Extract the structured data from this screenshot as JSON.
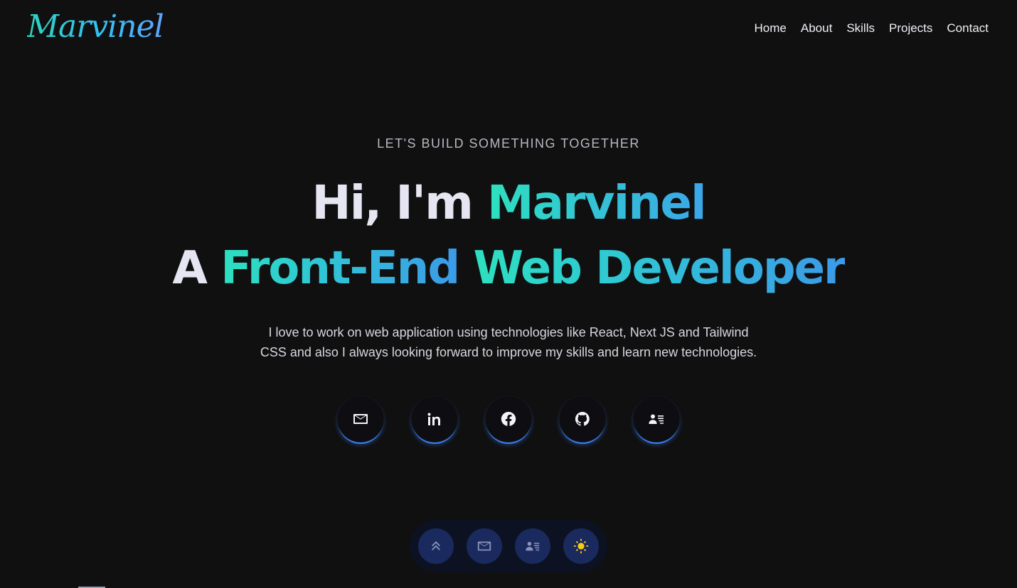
{
  "header": {
    "logo": "Marvinel",
    "nav": [
      {
        "label": "Home"
      },
      {
        "label": "About"
      },
      {
        "label": "Skills"
      },
      {
        "label": "Projects"
      },
      {
        "label": "Contact"
      }
    ]
  },
  "hero": {
    "tagline": "LET'S BUILD SOMETHING TOGETHER",
    "line1_prefix": "Hi, I'm ",
    "line1_name": "Marvinel",
    "line2_prefix": "A ",
    "line2_role_a": "Front-End",
    "line2_role_b": "Web Developer",
    "intro_line1": "I love to work on web application using technologies like React, Next JS and Tailwind",
    "intro_line2": "CSS and also I always looking forward to improve my skills and learn new technologies."
  },
  "socials": [
    {
      "icon": "mail-icon"
    },
    {
      "icon": "linkedin-icon"
    },
    {
      "icon": "facebook-icon"
    },
    {
      "icon": "github-icon"
    },
    {
      "icon": "resume-icon"
    }
  ],
  "dock": [
    {
      "icon": "chevrons-up-icon"
    },
    {
      "icon": "mail-icon"
    },
    {
      "icon": "resume-icon"
    },
    {
      "icon": "sun-icon"
    }
  ],
  "colors": {
    "background": "#101011",
    "accent_teal": "#2de0bf",
    "accent_blue": "#3b82f6",
    "dock_bg": "#0d1222",
    "dock_button": "#1a2a5e",
    "sun": "#facc15"
  }
}
